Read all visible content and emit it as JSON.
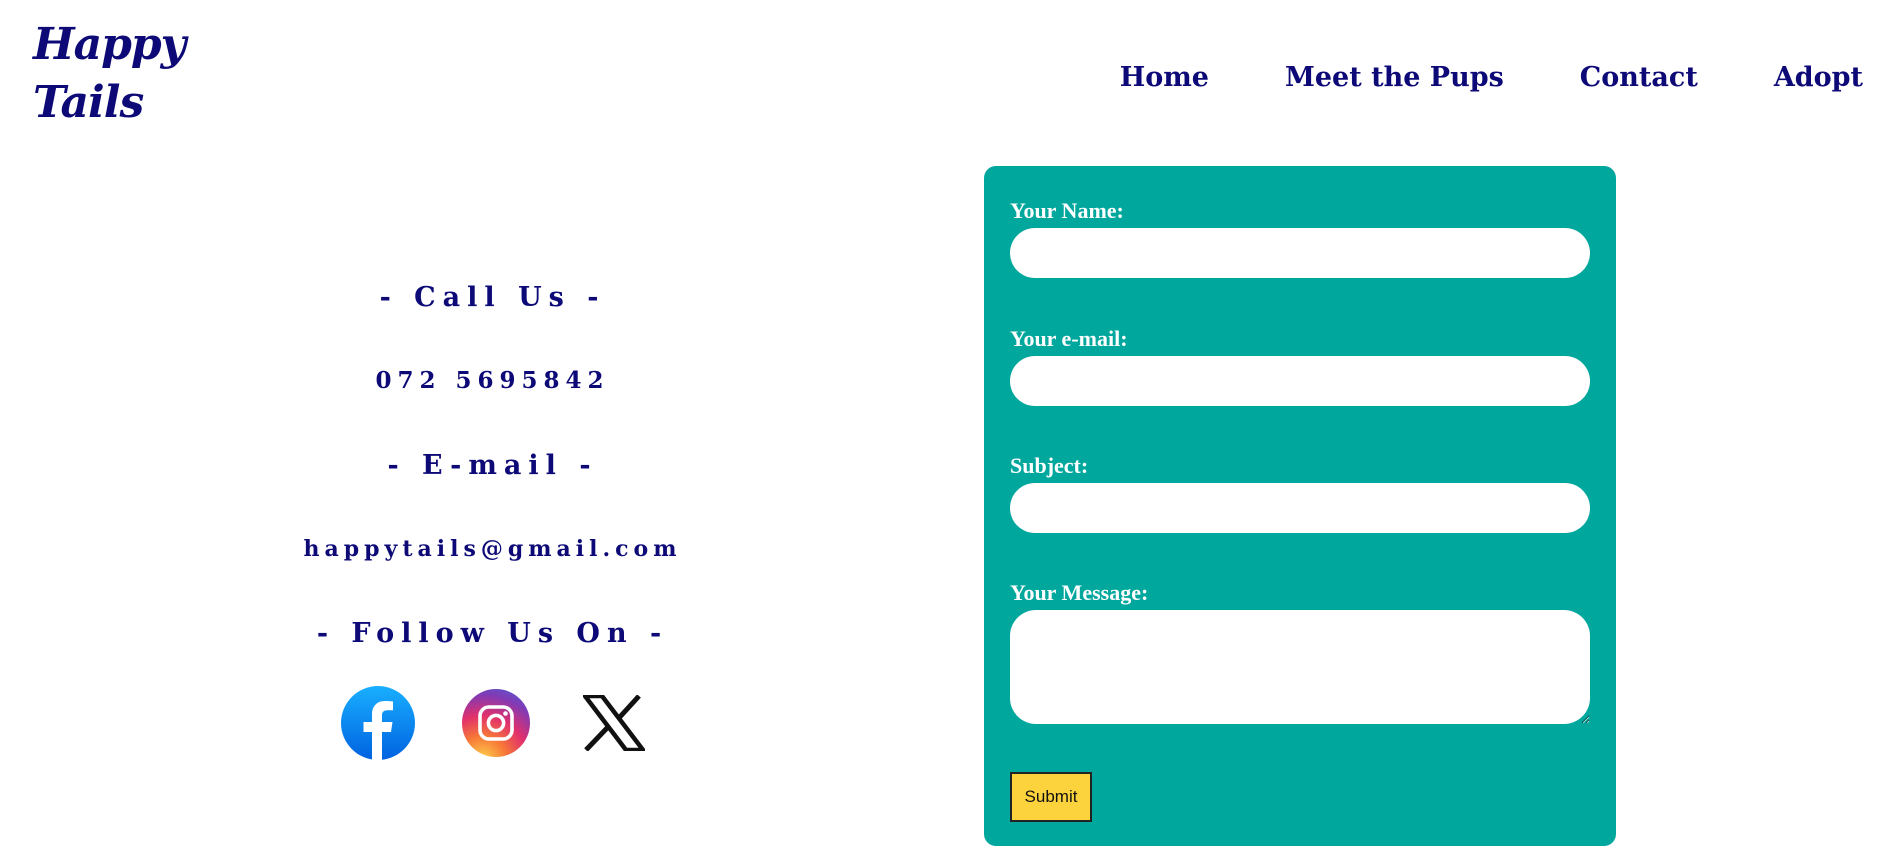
{
  "header": {
    "logo_line1": "Happy",
    "logo_line2": "Tails",
    "nav": [
      {
        "label": "Home"
      },
      {
        "label": "Meet the Pups"
      },
      {
        "label": "Contact"
      },
      {
        "label": "Adopt"
      }
    ]
  },
  "contact": {
    "call_heading": "- Call Us -",
    "phone": "072 5695842",
    "email_heading": "- E-mail -",
    "email": "happytails@gmail.com",
    "follow_heading": "- Follow Us On -",
    "socials": [
      {
        "icon": "facebook-icon"
      },
      {
        "icon": "instagram-icon"
      },
      {
        "icon": "x-icon"
      }
    ]
  },
  "form": {
    "name_label": "Your Name:",
    "name_value": "",
    "email_label": "Your e-mail:",
    "email_value": "",
    "subject_label": "Subject:",
    "subject_value": "",
    "message_label": "Your Message:",
    "message_value": "",
    "submit_label": "Submit"
  },
  "colors": {
    "brand_navy": "#0d0a78",
    "form_background": "#00a79d",
    "submit_background": "#fdd33d",
    "page_background": "#ffffff"
  }
}
